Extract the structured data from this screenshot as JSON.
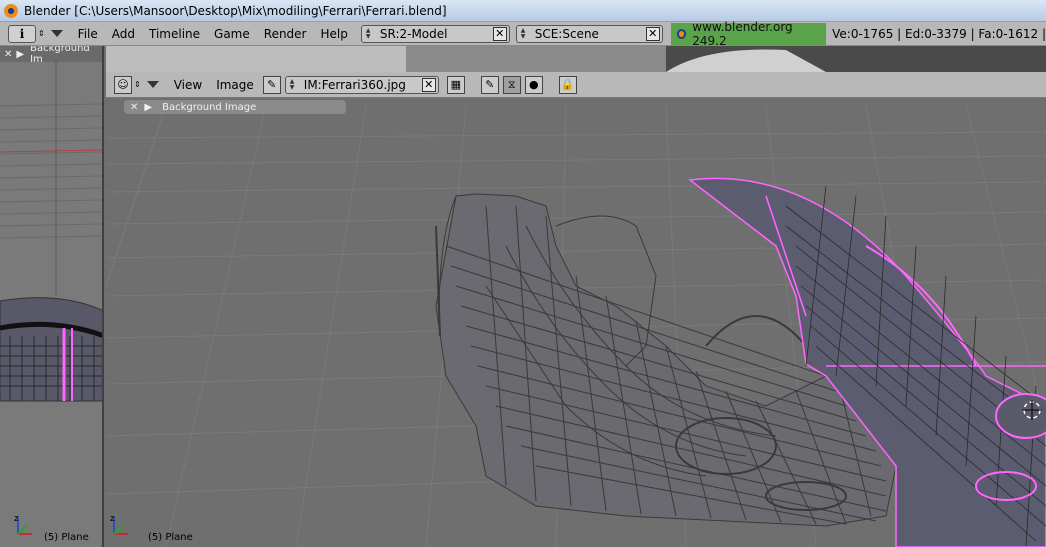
{
  "window": {
    "title": "Blender [C:\\Users\\Mansoor\\Desktop\\Mix\\modiling\\Ferrari\\Ferrari.blend]"
  },
  "infobar": {
    "menus": [
      "File",
      "Add",
      "Timeline",
      "Game",
      "Render",
      "Help"
    ],
    "screen_field": "SR:2-Model",
    "scene_field": "SCE:Scene",
    "website": "www.blender.org 249.2",
    "stats": "Ve:0-1765 | Ed:0-3379 | Fa:0-1612 |"
  },
  "left_viewport": {
    "bg_label": "Background Im",
    "object_label": "(5) Plane"
  },
  "main_viewport": {
    "menus": [
      "View",
      "Image"
    ],
    "image_field": "IM:Ferrari360.jpg",
    "bg_panel_label": "Background Image",
    "object_label": "(5) Plane"
  },
  "colors": {
    "selected_wire": "#ff66ff",
    "wire": "#3a3a3a",
    "grid": "#7a7a7a",
    "header": "#b8b8b8"
  }
}
